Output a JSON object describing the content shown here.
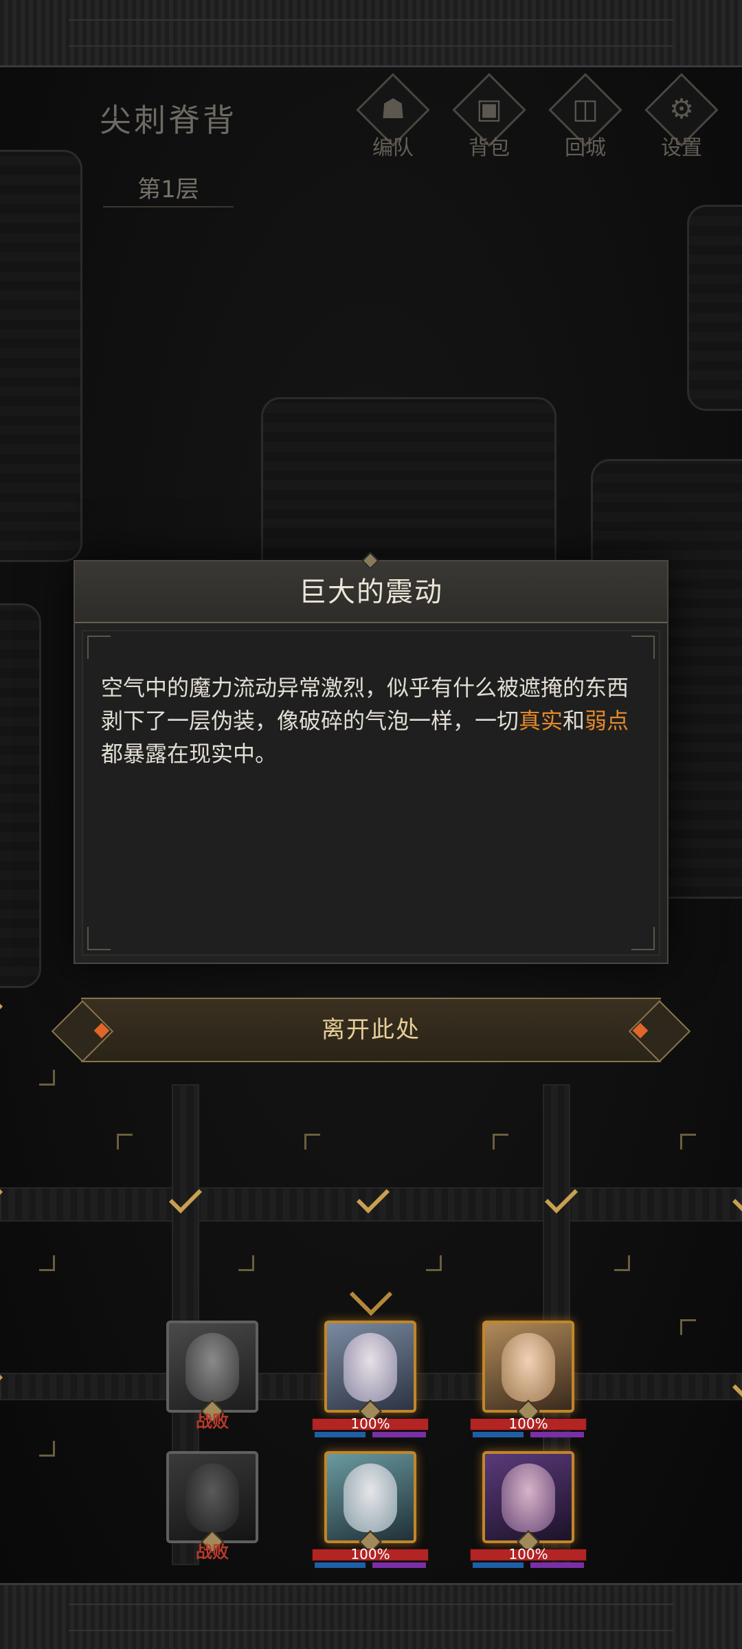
{
  "dungeon": {
    "name": "尖刺脊背",
    "floor": "第1层"
  },
  "menu": [
    {
      "key": "team",
      "label": "编队",
      "icon": "horned-helmet-icon",
      "glyph": "☗"
    },
    {
      "key": "bag",
      "label": "背包",
      "icon": "backpack-icon",
      "glyph": "▣"
    },
    {
      "key": "town",
      "label": "回城",
      "icon": "door-icon",
      "glyph": "◫"
    },
    {
      "key": "settings",
      "label": "设置",
      "icon": "gear-icon",
      "glyph": "⚙"
    }
  ],
  "event": {
    "title": "巨大的震动",
    "text_a": "空气中的魔力流动异常激烈，似乎有什么被遮掩的东西剥下了一层伪装，像破碎的气泡一样，一切",
    "highlight_1": "真实",
    "text_b": "和",
    "highlight_2": "弱点",
    "text_c": "都暴露在现实中。",
    "leave_label": "离开此处",
    "highlight_color": "#e48a2c"
  },
  "party": [
    {
      "slot": 1,
      "status": "战败",
      "hp_text": "",
      "hp": 0
    },
    {
      "slot": 2,
      "status": "",
      "hp_text": "100%",
      "hp": 1.0
    },
    {
      "slot": 3,
      "status": "",
      "hp_text": "100%",
      "hp": 1.0
    },
    {
      "slot": 4,
      "status": "战败",
      "hp_text": "",
      "hp": 0
    },
    {
      "slot": 5,
      "status": "",
      "hp_text": "100%",
      "hp": 1.0
    },
    {
      "slot": 6,
      "status": "",
      "hp_text": "100%",
      "hp": 1.0
    }
  ],
  "colors": {
    "accent_gold": "#c8a050",
    "hp_red": "#b32424",
    "defeat_red": "#b83a2a"
  }
}
